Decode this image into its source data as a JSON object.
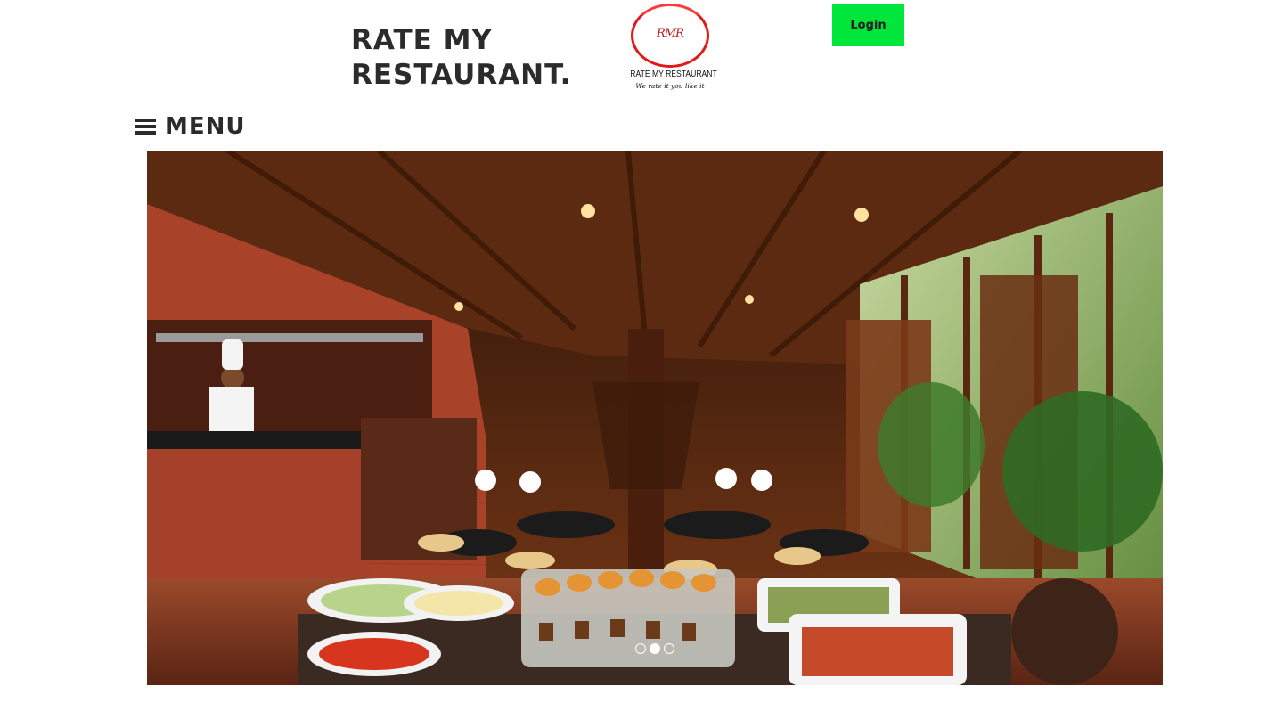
{
  "header": {
    "title_line1": "RATE MY",
    "title_line2": "RESTAURANT.",
    "logo": {
      "mark": "RMR",
      "name": "RATE MY RESTAURANT",
      "tagline": "We rate it you like it"
    },
    "login_label": "Login"
  },
  "nav": {
    "menu_label": "MENU",
    "menu_icon": "hamburger-icon"
  },
  "slider": {
    "image": "restaurant-interior-photo",
    "slide_count": 3,
    "active_slide": 2
  },
  "colors": {
    "login_bg": "#00e63a",
    "logo_red": "#e01a1a",
    "title_text": "#2b2b2b"
  }
}
